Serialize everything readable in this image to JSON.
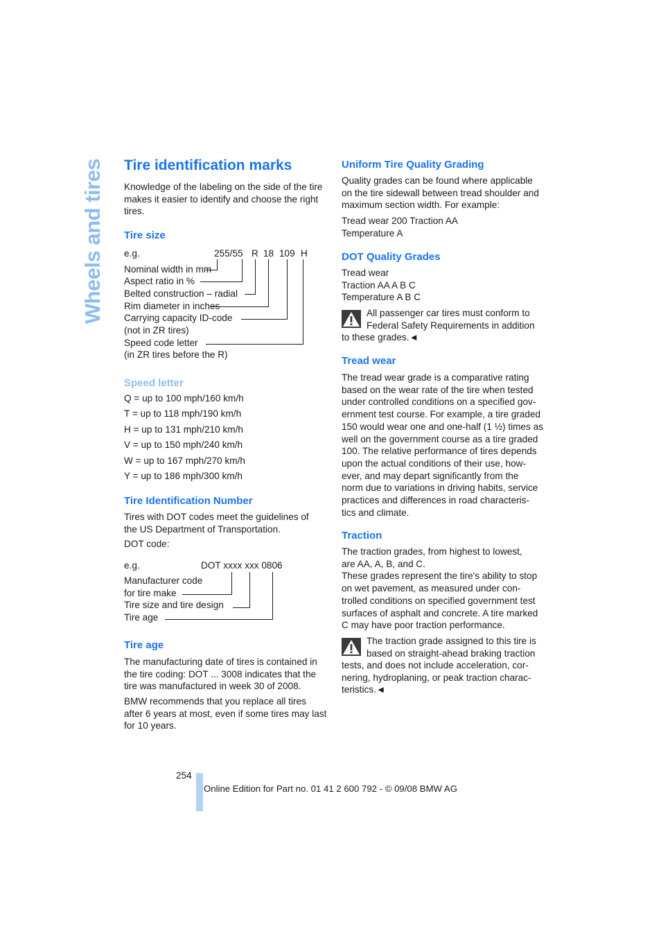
{
  "side_tab": "Wheels and tires",
  "left": {
    "title": "Tire identification marks",
    "intro": [
      "Knowledge of the labeling on the side of the tire",
      "makes it easier to identify and choose the right",
      "tires."
    ],
    "tire_size": {
      "heading": "Tire size",
      "example_label": "e.g.",
      "code_parts": [
        "255/55",
        "R",
        "18",
        "109",
        "H"
      ],
      "labels": [
        "Nominal width in mm",
        "Aspect ratio in %",
        "Belted construction – radial",
        "Rim diameter in inches",
        "Carrying capacity ID-code",
        "(not in ZR tires)",
        "Speed code letter",
        "(in ZR tires before the R)"
      ]
    },
    "speed_letter": {
      "heading": "Speed letter",
      "items": [
        "Q = up to 100 mph/160 km/h",
        "T = up to 118 mph/190 km/h",
        "H = up to 131 mph/210 km/h",
        "V = up to 150 mph/240 km/h",
        "W = up to 167 mph/270 km/h",
        "Y = up to 186 mph/300 km/h"
      ]
    },
    "tin": {
      "heading": "Tire Identification Number",
      "text": [
        "Tires with DOT codes meet the guidelines of",
        "the US Department of Transportation."
      ],
      "dot_code_label": "DOT code:",
      "example_label": "e.g.",
      "code": "DOT xxxx xxx 0806",
      "labels": [
        "Manufacturer code",
        "for tire make",
        "Tire size and tire design",
        "Tire age"
      ]
    },
    "tire_age": {
      "heading": "Tire age",
      "p1": [
        "The manufacturing date of tires is contained in",
        "the tire coding: DOT ... 3008 indicates that the",
        "tire was manufactured in week 30 of 2008."
      ],
      "p2": [
        "BMW recommends that you replace all tires",
        "after 6 years at most, even if some tires may last",
        "for 10 years."
      ]
    }
  },
  "right": {
    "utqg": {
      "heading": "Uniform Tire Quality Grading",
      "text": [
        "Quality grades can be found where applicable",
        "on the tire sidewall between tread shoulder and",
        "maximum section width. For example:"
      ],
      "example": [
        "Tread wear 200 Traction AA",
        "Temperature A"
      ]
    },
    "dot_grades": {
      "heading": "DOT Quality Grades",
      "items": [
        "Tread wear",
        "Traction AA A B C",
        "Temperature A B C"
      ],
      "warning": [
        "All passenger car tires must conform to",
        "Federal Safety Requirements in addition",
        "to these grades.◄"
      ]
    },
    "tread_wear": {
      "heading": "Tread wear",
      "text": [
        "The tread wear grade is a comparative rating",
        "based on the wear rate of the tire when tested",
        "under controlled conditions on a specified gov-",
        "ernment test course. For example, a tire graded",
        "150 would wear one and one-half (1 ½) times as",
        "well on the government course as a tire graded",
        "100. The relative performance of tires depends",
        "upon the actual conditions of their use, how-",
        "ever, and may depart significantly from the",
        "norm due to variations in driving habits, service",
        "practices and differences in road characteris-",
        "tics and climate."
      ]
    },
    "traction": {
      "heading": "Traction",
      "text": [
        "The traction grades, from highest to lowest,",
        "are AA, A, B, and C.",
        "These grades represent the tire's ability to stop",
        "on wet pavement, as measured under con-",
        "trolled conditions on specified government test",
        "surfaces of asphalt and concrete. A tire marked",
        "C may have poor traction performance."
      ],
      "warning": [
        "The traction grade assigned to this tire is",
        "based on straight-ahead braking traction",
        "tests, and does not include acceleration, cor-",
        "nering, hydroplaning, or peak traction charac-",
        "teristics.◄"
      ]
    }
  },
  "footer": {
    "page_number": "254",
    "text": "Online Edition for Part no. 01 41 2 600 792 - © 09/08 BMW AG"
  }
}
